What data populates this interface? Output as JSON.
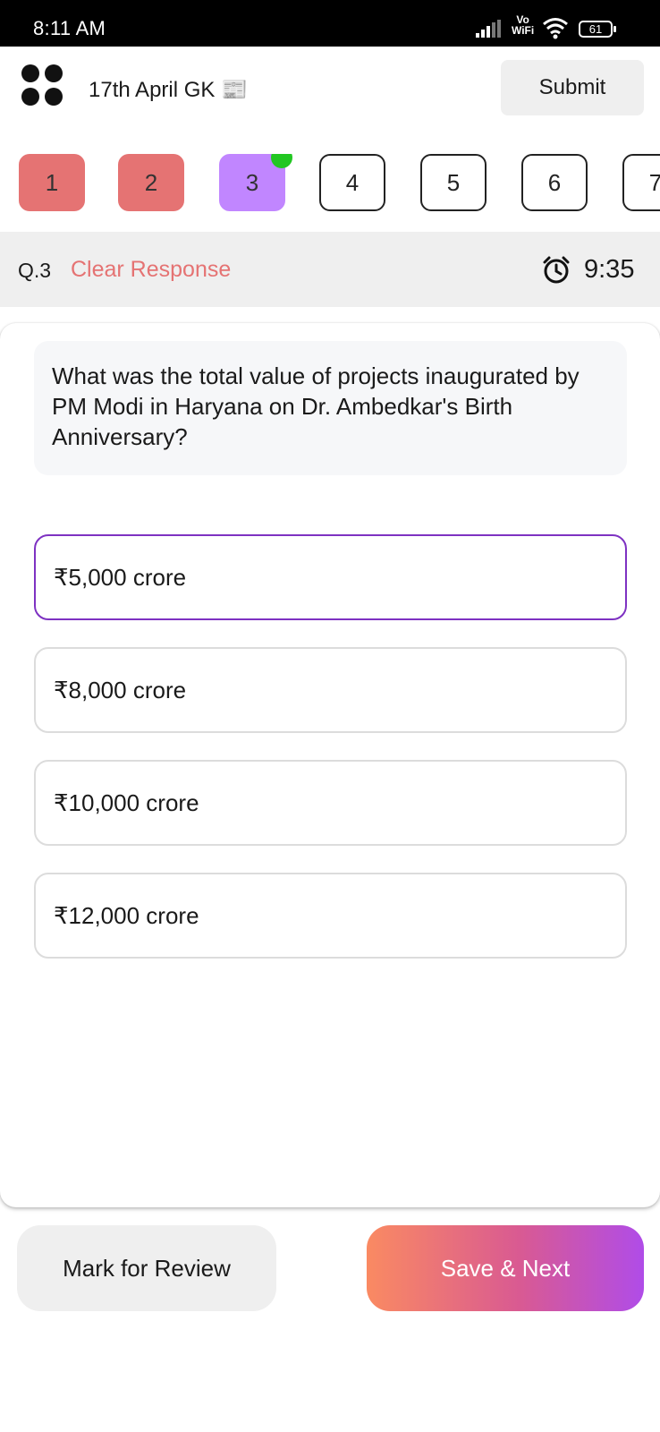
{
  "status_bar": {
    "time": "8:11 AM",
    "network_label_top": "Vo",
    "network_label_bottom": "WiFi",
    "battery": "61",
    "icons": [
      "signal-bars-icon",
      "wifi-icon",
      "battery-icon"
    ]
  },
  "header": {
    "menu_icon": "four-dots-menu-icon",
    "title": "17th April GK 📰",
    "submit_label": "Submit"
  },
  "question_nav": {
    "items": [
      {
        "label": "1",
        "state": "answered"
      },
      {
        "label": "2",
        "state": "answered"
      },
      {
        "label": "3",
        "state": "current"
      },
      {
        "label": "4",
        "state": "pending"
      },
      {
        "label": "5",
        "state": "pending"
      },
      {
        "label": "6",
        "state": "pending"
      },
      {
        "label": "7",
        "state": "pending"
      }
    ],
    "colors": {
      "answered": "#e57373",
      "current": "#c186ff",
      "indicator_dot": "#22c722"
    }
  },
  "info_bar": {
    "question_number": "Q.3",
    "clear_label": "Clear Response",
    "timer_icon": "alarm-clock-icon",
    "timer_value": "9:35"
  },
  "question": {
    "text": "What was the total value of projects inaugurated by PM Modi in Haryana on Dr. Ambedkar's Birth Anniversary?",
    "options": [
      {
        "label": "₹5,000 crore",
        "selected": true
      },
      {
        "label": "₹8,000 crore",
        "selected": false
      },
      {
        "label": "₹10,000 crore",
        "selected": false
      },
      {
        "label": "₹12,000 crore",
        "selected": false
      }
    ]
  },
  "footer": {
    "mark_review_label": "Mark for Review",
    "save_next_label": "Save & Next"
  }
}
